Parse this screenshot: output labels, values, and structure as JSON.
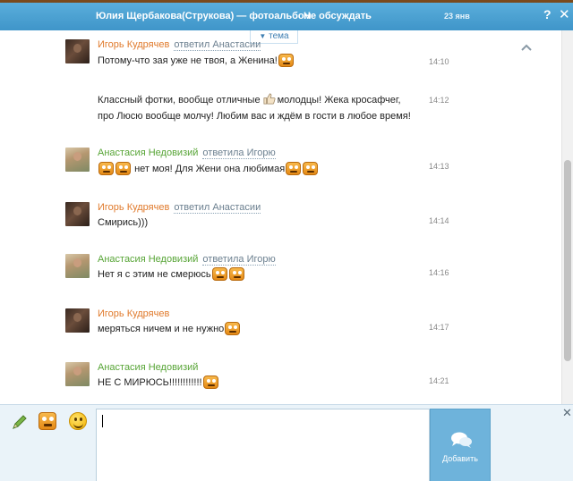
{
  "header": {
    "title": "Юлия Щербакова(Струкова) — фотоальбом",
    "discuss_label": "Не обсуждать",
    "date": "23 янв",
    "help_label": "?",
    "close_label": "✕"
  },
  "topic_tab": {
    "arrow": "▼",
    "label": "тема"
  },
  "messages": [
    {
      "author": "Игорь Кудрячев",
      "reply": "ответил Анастасии",
      "lines": [
        "Потому-что зая уже не твоя, а Женина!"
      ],
      "time": "14:10"
    },
    {
      "author": "",
      "reply": "",
      "lines": [
        "Классный фотки, вообще отличные",
        "молодцы! Жека кросафчег,",
        "про Люсю вообще молчу! Любим вас и ждём в гости в любое время!"
      ],
      "time": "14:12"
    },
    {
      "author": "Анастасия Недовизий",
      "reply": "ответила Игорю",
      "lines": [
        "нет моя! Для Жени она любимая"
      ],
      "time": "14:13"
    },
    {
      "author": "Игорь Кудрячев",
      "reply": "ответил Анастасии",
      "lines": [
        "Смирись)))"
      ],
      "time": "14:14"
    },
    {
      "author": "Анастасия Недовизий",
      "reply": "ответила Игорю",
      "lines": [
        "Нет я с этим не смерюсь"
      ],
      "time": "14:16"
    },
    {
      "author": "Игорь Кудрячев",
      "reply": "",
      "lines": [
        "меряться ничем и не нужно"
      ],
      "time": "14:17"
    },
    {
      "author": "Анастасия Недовизий",
      "reply": "",
      "lines": [
        "НЕ С МИРЮСЬ!!!!!!!!!!!!"
      ],
      "time": "14:21"
    }
  ],
  "composer": {
    "input_value": "",
    "send_label": "Добавить",
    "close_label": "✕"
  },
  "icons": {
    "pencil": "pencil-icon",
    "sticker": "sticker-icon",
    "emoji": "emoji-icon",
    "send": "speech-bubbles-icon"
  },
  "colors": {
    "header_bg": "#4aa3d6",
    "author_male": "#e07a2c",
    "author_female": "#58a537",
    "send_button": "#6eb3db"
  }
}
